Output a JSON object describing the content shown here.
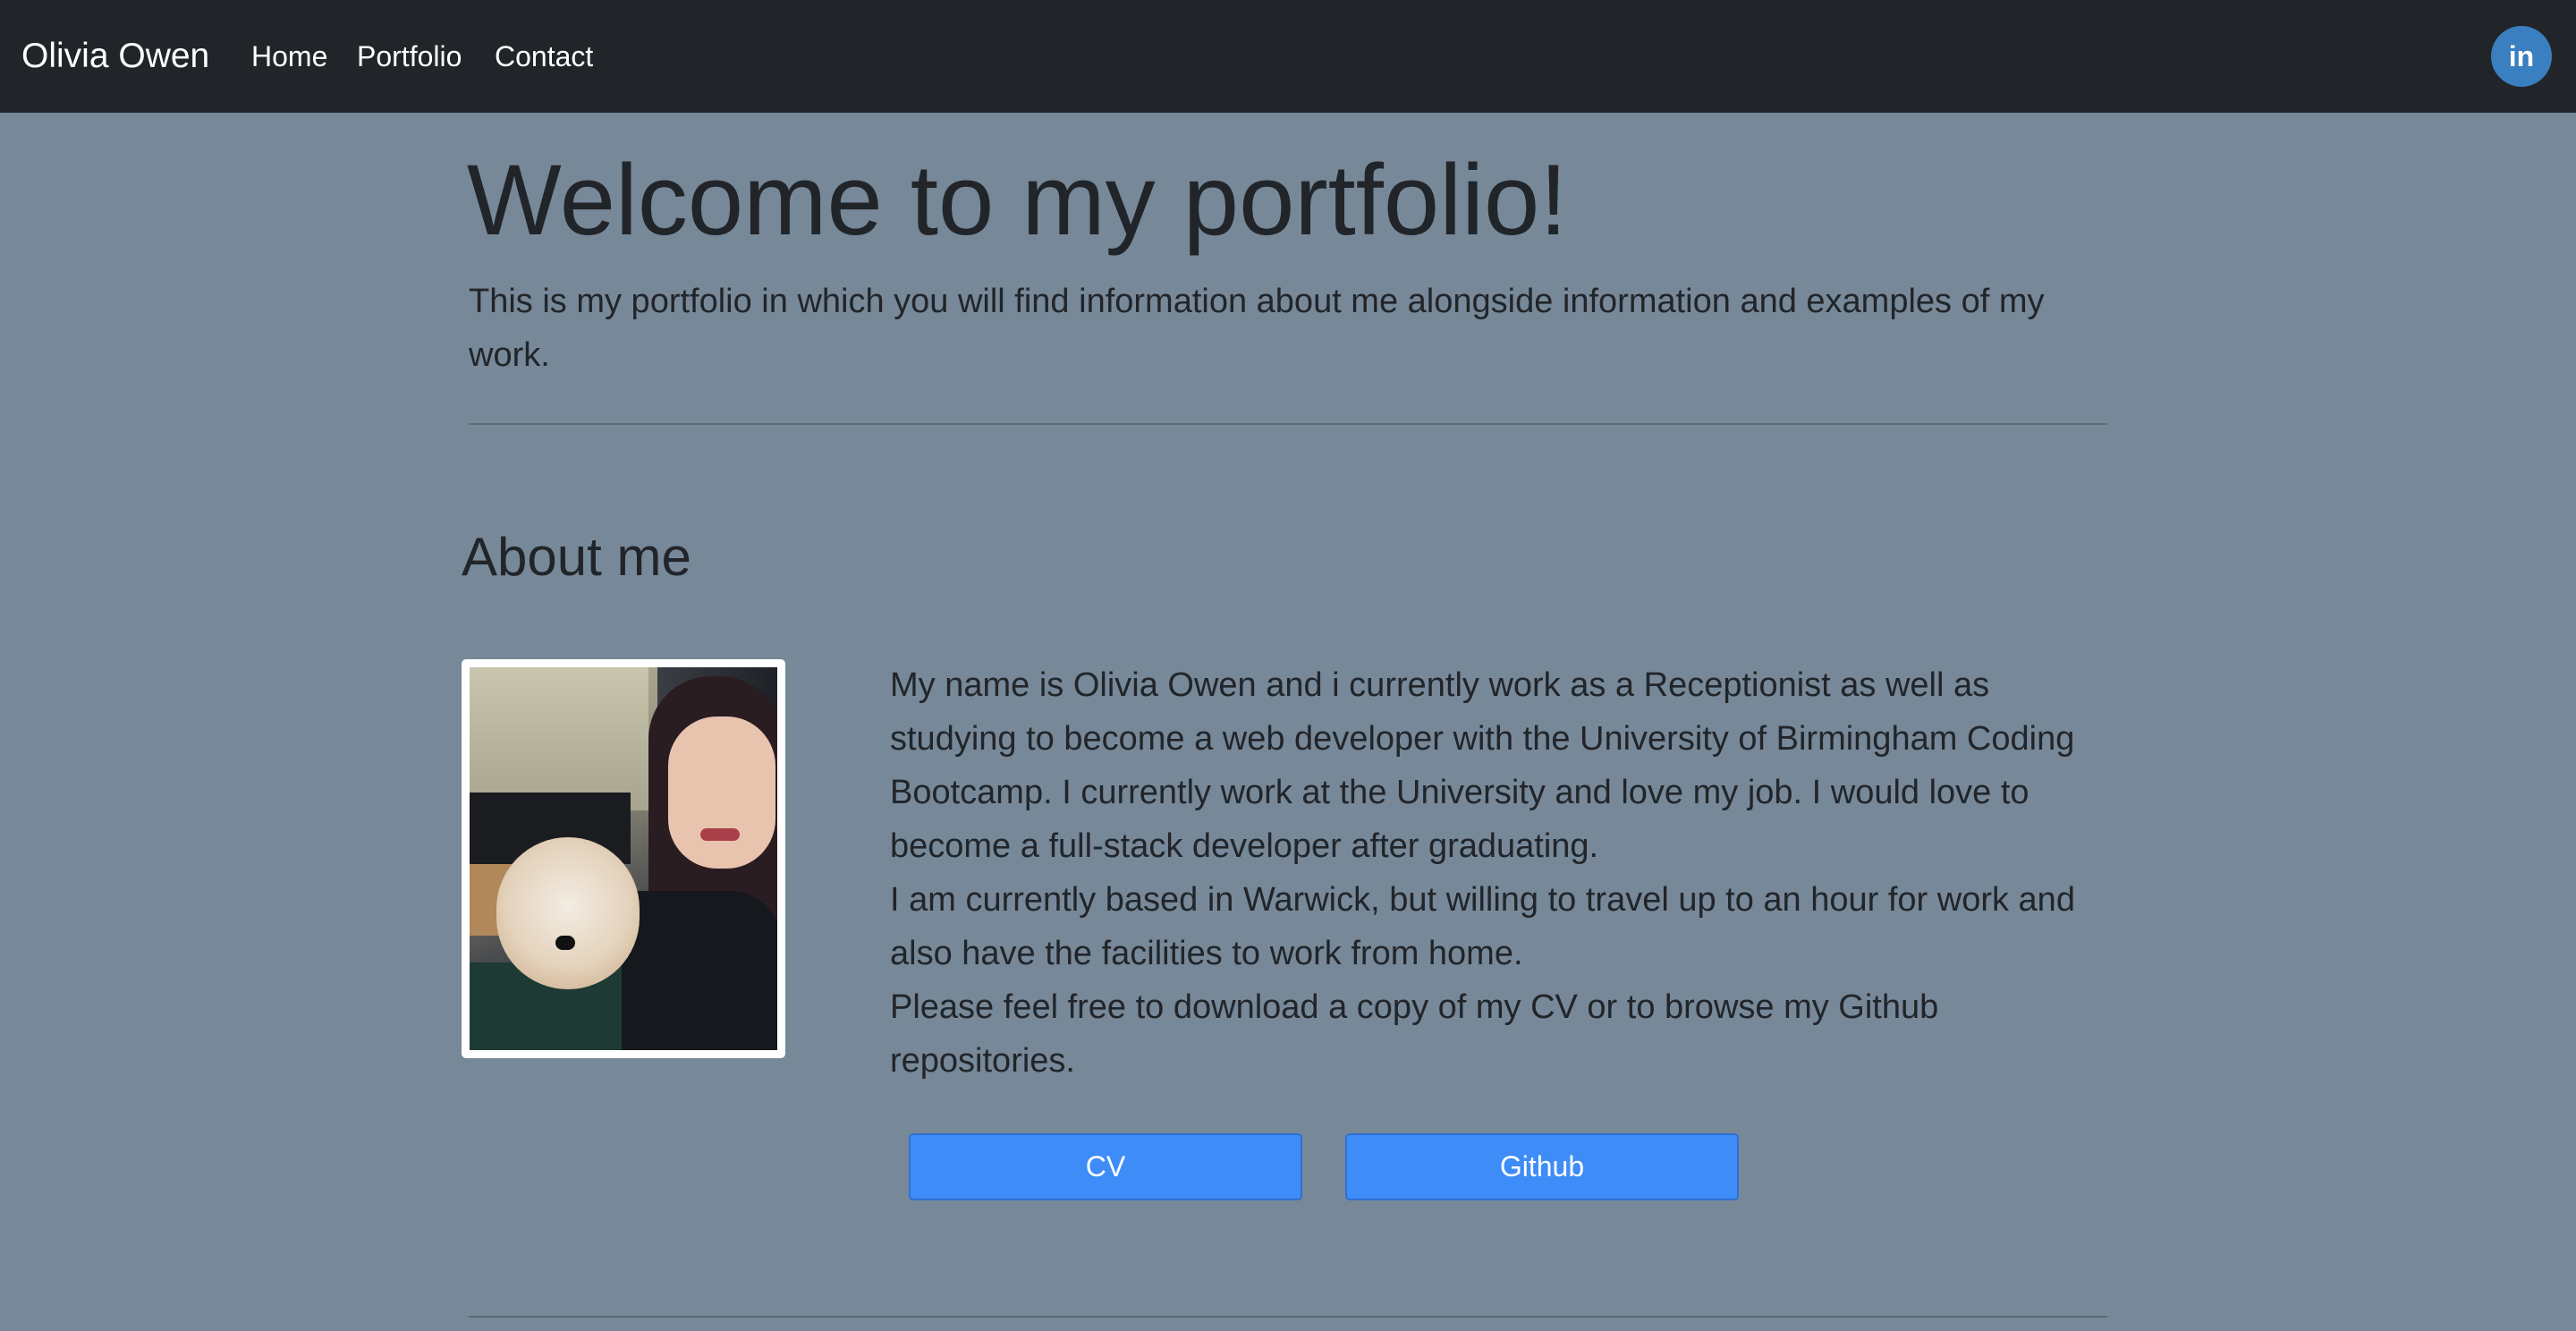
{
  "navbar": {
    "brand": "Olivia Owen",
    "links": [
      {
        "label": "Home"
      },
      {
        "label": "Portfolio"
      },
      {
        "label": "Contact"
      }
    ],
    "social": {
      "label": "in",
      "icon": "linkedin-icon"
    },
    "background": "#212529"
  },
  "hero": {
    "title": "Welcome to my portfolio!",
    "lead": "This is my portfolio in which you will find information about me alongside information and examples of my work."
  },
  "about": {
    "heading": "About me",
    "paragraphs": [
      "My name is Olivia Owen and i currently work as a Receptionist as well as studying to become a web developer with the University of Birmingham Coding Bootcamp. I currently work at the University and love my job. I would love to become a full-stack developer after graduating.",
      "I am currently based in Warwick, but willing to travel up to an hour for work and also have the facilities to work from home.",
      "Please feel free to download a copy of my CV or to browse my Github repositories."
    ],
    "buttons": {
      "cv": "CV",
      "github": "Github"
    }
  },
  "colors": {
    "page_background": "#778899",
    "button": "#3e8cf7",
    "linkedin": "#3a7fbf"
  }
}
